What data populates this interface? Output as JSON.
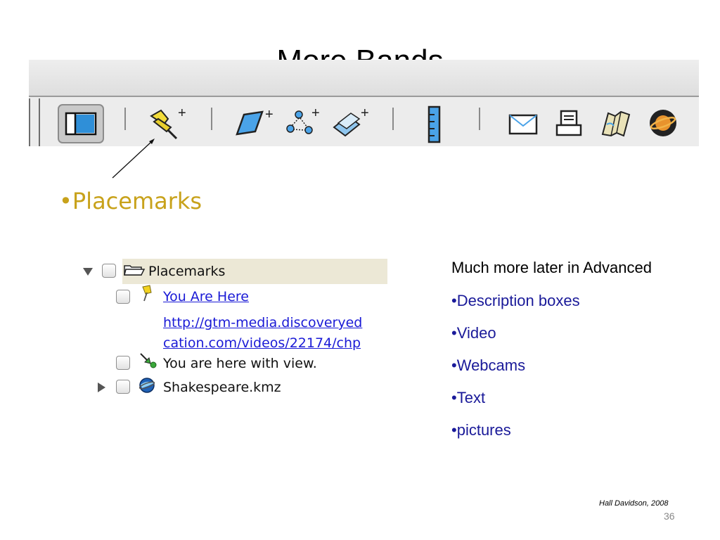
{
  "slide": {
    "title": "More Bands",
    "page_number": "36",
    "credit": "Hall Davidson, 2008"
  },
  "toolbar": {
    "buttons": [
      {
        "name": "sidebar-toggle-button",
        "icon": "sidebar-icon"
      },
      {
        "name": "add-placemark-button",
        "icon": "pushpin-plus-icon"
      },
      {
        "name": "add-polygon-button",
        "icon": "polygon-plus-icon"
      },
      {
        "name": "add-path-button",
        "icon": "path-plus-icon"
      },
      {
        "name": "add-image-overlay-button",
        "icon": "image-overlay-plus-icon"
      },
      {
        "name": "ruler-button",
        "icon": "ruler-icon"
      },
      {
        "name": "email-button",
        "icon": "envelope-icon"
      },
      {
        "name": "print-button",
        "icon": "printer-icon"
      },
      {
        "name": "maps-button",
        "icon": "map-icon"
      },
      {
        "name": "sky-button",
        "icon": "planet-icon"
      }
    ]
  },
  "heading": {
    "label": "•Placemarks",
    "color": "#c8a21b"
  },
  "places": {
    "folder": {
      "label": "Placemarks",
      "icon": "folder-open-icon"
    },
    "items": [
      {
        "label": "You Are Here",
        "icon": "yellow-pushpin-icon",
        "link": true
      },
      {
        "label": "http://gtm-media.discoveryed",
        "link": true
      },
      {
        "label": "cation.com/videos/22174/chp",
        "link": true
      },
      {
        "label": "You are here with view.",
        "icon": "green-arrow-icon",
        "link": false
      },
      {
        "label": "Shakespeare.kmz",
        "icon": "globe-icon",
        "link": false
      }
    ]
  },
  "info": {
    "heading": "Much more later in Advanced",
    "bullets": [
      "•Description boxes",
      "•Video",
      "•Webcams",
      "•Text",
      "•pictures"
    ],
    "bullet_color": "#1a1a99"
  }
}
